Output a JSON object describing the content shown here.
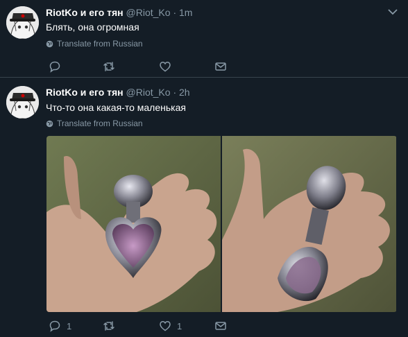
{
  "tweets": [
    {
      "author_name": "RiotKo и его тян",
      "author_handle": "@Riot_Ko",
      "separator": "·",
      "time": "1m",
      "text": "Блять, она огромная",
      "translate_label": "Translate from Russian",
      "actions": {
        "reply_count": "",
        "retweet_count": "",
        "like_count": ""
      }
    },
    {
      "author_name": "RiotKo и его тян",
      "author_handle": "@Riot_Ko",
      "separator": "·",
      "time": "2h",
      "text": "Что-то она какая-то маленькая",
      "translate_label": "Translate from Russian",
      "actions": {
        "reply_count": "1",
        "retweet_count": "",
        "like_count": "1"
      }
    }
  ],
  "colors": {
    "background": "#141d26",
    "secondary_text": "#8899a6",
    "divider": "#38444d"
  },
  "icons": [
    "avatar",
    "chevron-down-icon",
    "globe-icon",
    "reply-icon",
    "retweet-icon",
    "like-icon",
    "message-icon"
  ]
}
